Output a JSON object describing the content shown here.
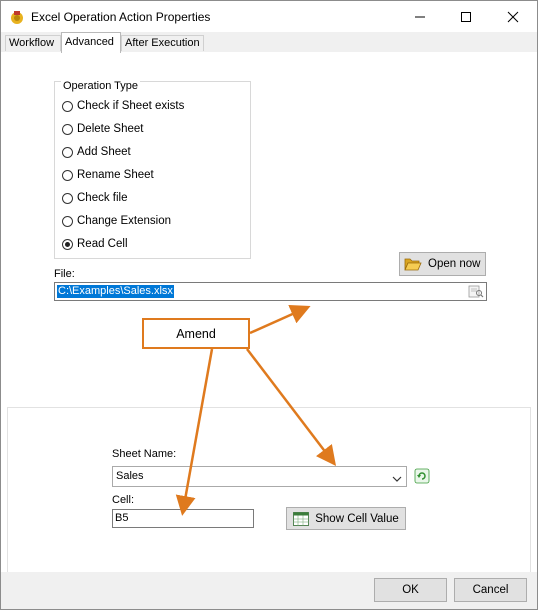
{
  "window": {
    "title": "Excel Operation Action Properties"
  },
  "tabs": [
    {
      "label": "Workflow",
      "active": false
    },
    {
      "label": "Advanced",
      "active": true
    },
    {
      "label": "After Execution",
      "active": false
    }
  ],
  "operation_type": {
    "legend": "Operation Type",
    "options": [
      {
        "label": "Check if Sheet exists",
        "selected": false
      },
      {
        "label": "Delete Sheet",
        "selected": false
      },
      {
        "label": "Add Sheet",
        "selected": false
      },
      {
        "label": "Rename Sheet",
        "selected": false
      },
      {
        "label": "Check file",
        "selected": false
      },
      {
        "label": "Change Extension",
        "selected": false
      },
      {
        "label": "Read Cell",
        "selected": true
      }
    ]
  },
  "open_now": {
    "label": "Open now",
    "icon": "open-folder-icon"
  },
  "file": {
    "label": "File:",
    "value": "C:\\Examples\\Sales.xlsx",
    "browse_icon": "browse-file-icon"
  },
  "annotation": {
    "label": "Amend",
    "color": "#df7a1e"
  },
  "sheet": {
    "label": "Sheet Name:",
    "value": "Sales",
    "refresh_icon": "refresh-icon"
  },
  "cell": {
    "label": "Cell:",
    "value": "B5"
  },
  "show_cell_value": {
    "label": "Show Cell Value",
    "icon": "excel-sheet-icon"
  },
  "footer": {
    "ok_label": "OK",
    "cancel_label": "Cancel"
  }
}
